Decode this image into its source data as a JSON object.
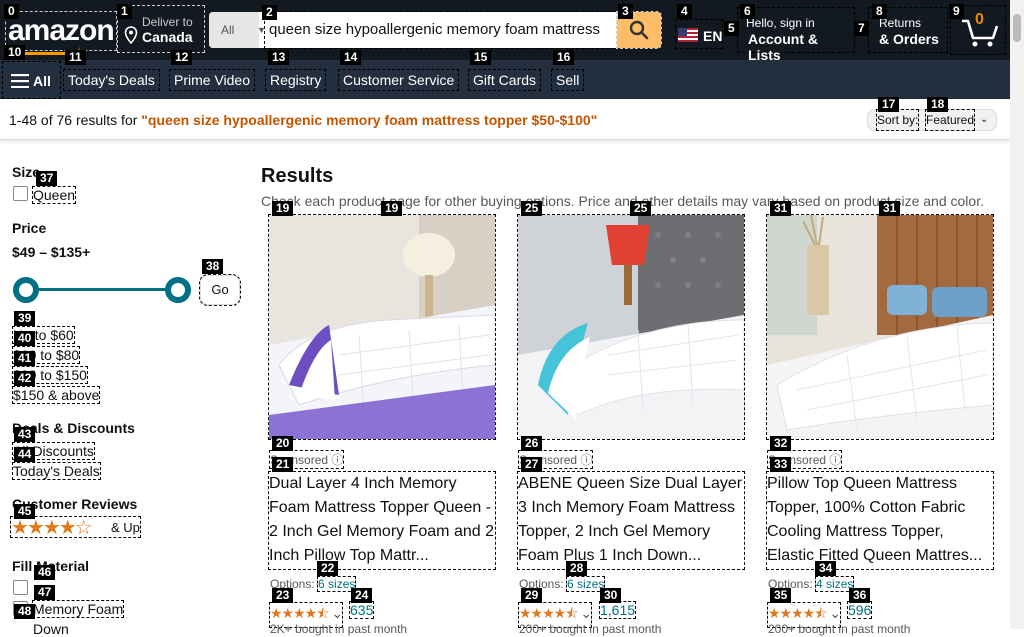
{
  "header": {
    "logo": "amazon",
    "deliver_small": "Deliver to",
    "deliver_big": "Canada",
    "search_category": "All",
    "search_query": "queen size hypoallergenic memory foam mattress",
    "language": "EN",
    "account_small": "Hello, sign in",
    "account_big": "Account & Lists",
    "returns_small": "Returns",
    "returns_big": "& Orders",
    "cart_count": "0"
  },
  "subnav": {
    "all": "All",
    "items": [
      "Today's Deals",
      "Prime Video",
      "Registry",
      "Customer Service",
      "Gift Cards",
      "Sell"
    ]
  },
  "results_bar": {
    "count": "1-48 of 76 results for ",
    "query": "\"queen size hypoallergenic memory foam mattress topper $50-$100\"",
    "sort_label": "Sort by:",
    "sort_value": "Featured"
  },
  "filters": {
    "size_heading": "Size",
    "size_option": "Queen",
    "price_heading": "Price",
    "price_range": "$49 – $135+",
    "go": "Go",
    "price_links": [
      "Up to $60",
      "$60 to $80",
      "$80 to $150",
      "$150 & above"
    ],
    "deals_heading": "Deals & Discounts",
    "deals_links": [
      "All Discounts",
      "Today's Deals"
    ],
    "reviews_heading": "Customer Reviews",
    "reviews_rating": 4,
    "reviews_up": "& Up",
    "fill_heading": "Fill Material",
    "fill_options": [
      "Memory Foam",
      "Down"
    ]
  },
  "main": {
    "title": "Results",
    "subtitle": "Check each product page for other buying options. Price and other details may vary based on product size and color.",
    "sponsored": "Sponsored",
    "options_label": "Options:",
    "products": [
      {
        "title": "Dual Layer 4 Inch Memory Foam Mattress Topper Queen - 2 Inch Gel Memory Foam and 2 Inch Pillow Top Mattr...",
        "sizes": "6 sizes",
        "rating": 4.5,
        "reviews": "635",
        "bought": "2K+ bought in past month"
      },
      {
        "title": "ABENE Queen Size Dual Layer 3 Inch Memory Foam Mattress Topper, 2 Inch Gel Memory Foam Plus 1 Inch Down...",
        "sizes": "6 sizes",
        "rating": 4.5,
        "reviews": "1,615",
        "bought": "200+ bought in past month"
      },
      {
        "title": "Pillow Top Queen Mattress Topper, 100% Cotton Fabric Cooling Mattress Topper, Elastic Fitted Queen Mattres...",
        "sizes": "4 sizes",
        "rating": 4.5,
        "reviews": "596",
        "bought": "200+ bought in past month"
      }
    ]
  },
  "marks": [
    "0",
    "1",
    "2",
    "3",
    "4",
    "5",
    "6",
    "7",
    "8",
    "9",
    "10",
    "11",
    "12",
    "13",
    "14",
    "15",
    "16",
    "17",
    "18",
    "19",
    "20",
    "21",
    "22",
    "23",
    "24",
    "25",
    "26",
    "27",
    "28",
    "29",
    "30",
    "31",
    "32",
    "33",
    "34",
    "35",
    "36",
    "37",
    "38",
    "39",
    "40",
    "41",
    "42",
    "43",
    "44",
    "45",
    "46",
    "47",
    "48"
  ],
  "colors": {
    "nav_top": "#131921",
    "nav_bottom": "#232f3e",
    "accent": "#febd69",
    "link": "#007185",
    "query": "#c45500",
    "star": "#de7921"
  }
}
